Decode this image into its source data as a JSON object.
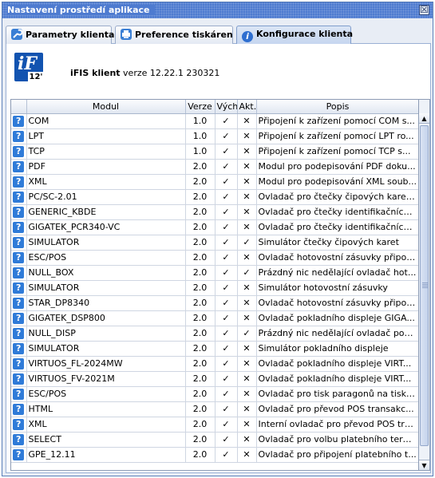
{
  "window": {
    "title": "Nastavení prostředí aplikace",
    "close_symbol": "☒"
  },
  "tabs": [
    {
      "label": "Parametry klienta",
      "icon": "wrench-icon",
      "active": false
    },
    {
      "label": "Preference tiskáren",
      "icon": "printer-icon",
      "active": false
    },
    {
      "label": "Konfigurace klienta",
      "icon": "info-icon",
      "active": true
    }
  ],
  "product": {
    "logo_letter": "iF",
    "logo_badge": "12'",
    "name": "iFIS klient",
    "version_text": "verze 12.22.1 230321"
  },
  "table": {
    "columns": [
      "",
      "Modul",
      "Verze",
      "Vých.",
      "Akt.",
      "Popis"
    ],
    "rows": [
      {
        "module": "COM",
        "version": "1.0",
        "default": "✓",
        "active": "✕",
        "description": "Připojení k zařízení pomocí COM s..."
      },
      {
        "module": "LPT",
        "version": "1.0",
        "default": "✓",
        "active": "✕",
        "description": "Připojení k zařízení pomocí LPT ro..."
      },
      {
        "module": "TCP",
        "version": "1.0",
        "default": "✓",
        "active": "✕",
        "description": "Připojení k zařízení pomocí TCP s..."
      },
      {
        "module": "PDF",
        "version": "2.0",
        "default": "✓",
        "active": "✕",
        "description": "Modul pro podepisování PDF doku..."
      },
      {
        "module": "XML",
        "version": "2.0",
        "default": "✓",
        "active": "✕",
        "description": "Modul pro podepisování XML soub..."
      },
      {
        "module": "PC/SC-2.01",
        "version": "2.0",
        "default": "✓",
        "active": "✕",
        "description": "Ovladač pro čtečky čipových karet ..."
      },
      {
        "module": "GENERIC_KBDE",
        "version": "2.0",
        "default": "✓",
        "active": "✕",
        "description": "Ovladač pro čtečky identifikačních ..."
      },
      {
        "module": "GIGATEK_PCR340-VC",
        "version": "2.0",
        "default": "✓",
        "active": "✕",
        "description": "Ovladač pro čtečky identifikačních ..."
      },
      {
        "module": "SIMULATOR",
        "version": "2.0",
        "default": "✓",
        "active": "✓",
        "description": "Simulátor čtečky čipových karet"
      },
      {
        "module": "ESC/POS",
        "version": "2.0",
        "default": "✓",
        "active": "✕",
        "description": "Ovladač hotovostní zásuvky připoje..."
      },
      {
        "module": "NULL_BOX",
        "version": "2.0",
        "default": "✓",
        "active": "✓",
        "description": "Prázdný nic nedělající ovladač hot..."
      },
      {
        "module": "SIMULATOR",
        "version": "2.0",
        "default": "✓",
        "active": "✕",
        "description": "Simulátor hotovostní zásuvky"
      },
      {
        "module": "STAR_DP8340",
        "version": "2.0",
        "default": "✓",
        "active": "✕",
        "description": "Ovladač hotovostní zásuvky připoje..."
      },
      {
        "module": "GIGATEK_DSP800",
        "version": "2.0",
        "default": "✓",
        "active": "✕",
        "description": "Ovladač pokladního displeje GIGA..."
      },
      {
        "module": "NULL_DISP",
        "version": "2.0",
        "default": "✓",
        "active": "✓",
        "description": "Prázdný nic nedělající ovladač pokl..."
      },
      {
        "module": "SIMULATOR",
        "version": "2.0",
        "default": "✓",
        "active": "✕",
        "description": "Simulátor pokladního displeje"
      },
      {
        "module": "VIRTUOS_FL-2024MW",
        "version": "2.0",
        "default": "✓",
        "active": "✕",
        "description": "Ovladač pokladního displeje VIRT..."
      },
      {
        "module": "VIRTUOS_FV-2021M",
        "version": "2.0",
        "default": "✓",
        "active": "✕",
        "description": "Ovladač pokladního displeje VIRT..."
      },
      {
        "module": "ESC/POS",
        "version": "2.0",
        "default": "✓",
        "active": "✕",
        "description": "Ovladač pro tisk paragonů na tiská..."
      },
      {
        "module": "HTML",
        "version": "2.0",
        "default": "✓",
        "active": "✕",
        "description": "Ovladač pro převod POS transakc..."
      },
      {
        "module": "XML",
        "version": "2.0",
        "default": "✓",
        "active": "✕",
        "description": "Interní ovladač pro převod POS tra..."
      },
      {
        "module": "SELECT",
        "version": "2.0",
        "default": "✓",
        "active": "✕",
        "description": "Ovladač pro volbu platebního termi..."
      },
      {
        "module": "GPE_12.11",
        "version": "2.0",
        "default": "✓",
        "active": "✕",
        "description": "Ovladač pro připojení platebního t..."
      }
    ]
  },
  "row_icon": {
    "glyph": "?",
    "name": "help-icon"
  },
  "scrollbar": {
    "up_glyph": "▲",
    "down_glyph": "▼"
  },
  "colors": {
    "accent": "#4e7bd0",
    "icon_blue": "#2f7bd8",
    "logo": "#1253b0"
  }
}
